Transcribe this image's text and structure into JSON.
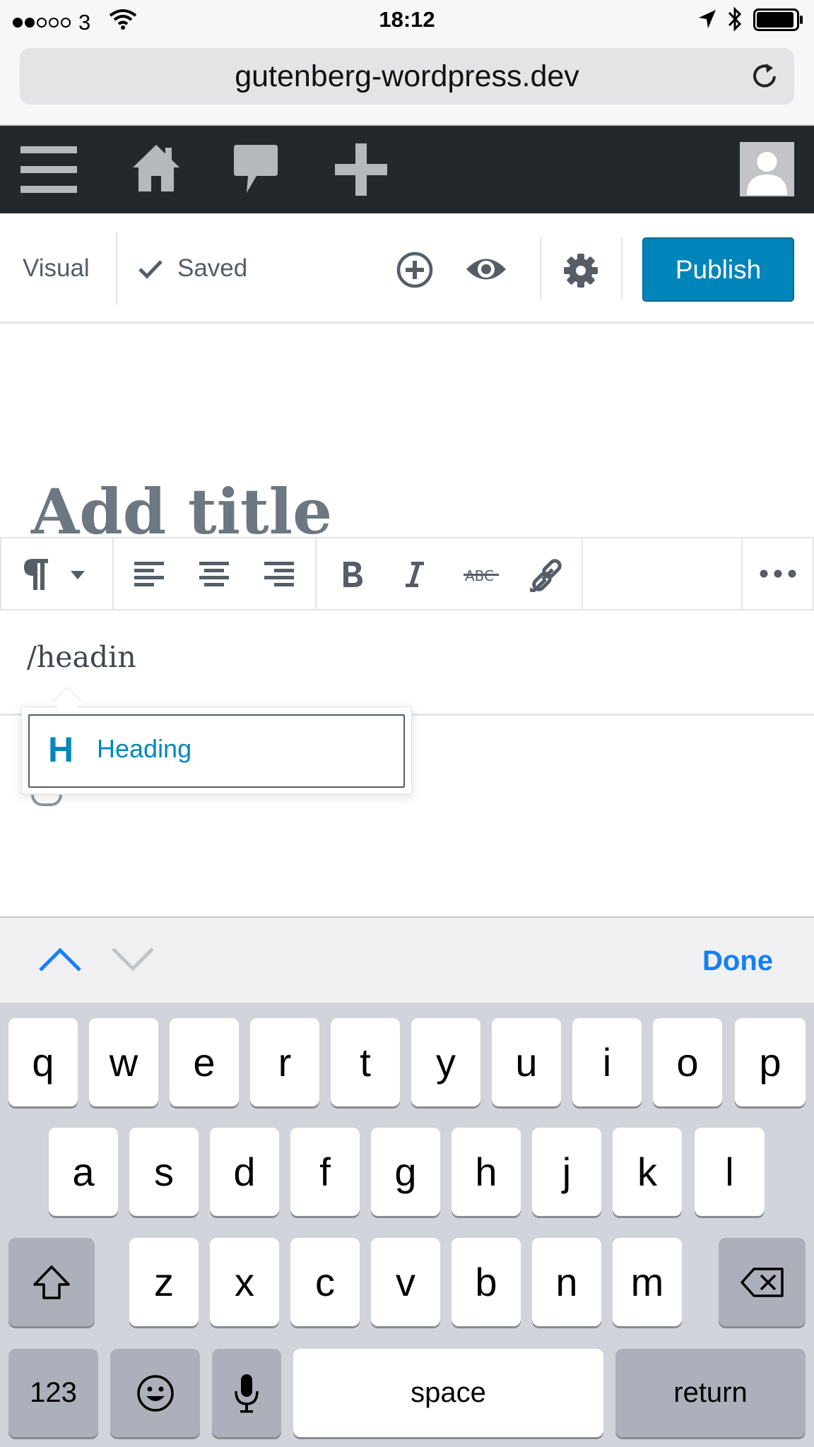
{
  "status_bar": {
    "carrier": "3",
    "time": "18:12"
  },
  "browser": {
    "url": "gutenberg-wordpress.dev"
  },
  "admin_bar": {
    "icons": [
      "menu-icon",
      "home-icon",
      "comments-icon",
      "add-new-icon",
      "avatar"
    ]
  },
  "editor_header": {
    "mode_label": "Visual",
    "saved_label": "Saved",
    "publish_label": "Publish"
  },
  "editor": {
    "title_placeholder": "Add title",
    "paragraph_text": "/headin"
  },
  "autocomplete": {
    "items": [
      {
        "icon_text": "H",
        "label": "Heading"
      }
    ]
  },
  "keyboard_accessory": {
    "done_label": "Done"
  },
  "keyboard": {
    "row1": [
      "q",
      "w",
      "e",
      "r",
      "t",
      "y",
      "u",
      "i",
      "o",
      "p"
    ],
    "row2": [
      "a",
      "s",
      "d",
      "f",
      "g",
      "h",
      "j",
      "k",
      "l"
    ],
    "row3": [
      "z",
      "x",
      "c",
      "v",
      "b",
      "n",
      "m"
    ],
    "numbers_label": "123",
    "space_label": "space",
    "return_label": "return"
  },
  "colors": {
    "admin_bar_bg": "#23282d",
    "publish_bg": "#0085ba",
    "link_blue": "#0087be",
    "ios_blue": "#157efb"
  }
}
